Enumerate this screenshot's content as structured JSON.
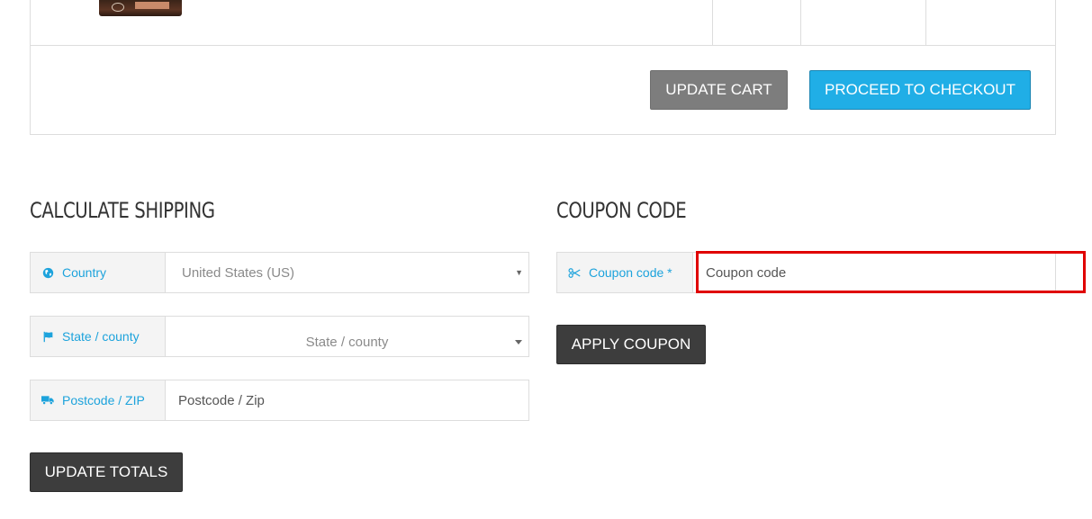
{
  "cart": {
    "update_cart_label": "UPDATE CART",
    "checkout_label": "PROCEED TO CHECKOUT"
  },
  "shipping": {
    "title": "CALCULATE SHIPPING",
    "country": {
      "label": "Country",
      "icon": "globe-icon",
      "value": "United States (US)"
    },
    "state": {
      "label": "State / county",
      "icon": "flag-icon",
      "value": "State / county"
    },
    "postcode": {
      "label": "Postcode / ZIP",
      "icon": "truck-icon",
      "placeholder": "Postcode / Zip"
    },
    "update_totals_label": "UPDATE TOTALS"
  },
  "coupon": {
    "title": "COUPON CODE",
    "label": "Coupon code *",
    "icon": "scissors-icon",
    "placeholder": "Coupon code",
    "apply_label": "APPLY COUPON"
  },
  "colors": {
    "accent": "#20aee6",
    "label_text": "#1da3dc",
    "dark_button": "#3d3d3d",
    "grey_button": "#7d7d7d",
    "highlight": "#e00000"
  }
}
